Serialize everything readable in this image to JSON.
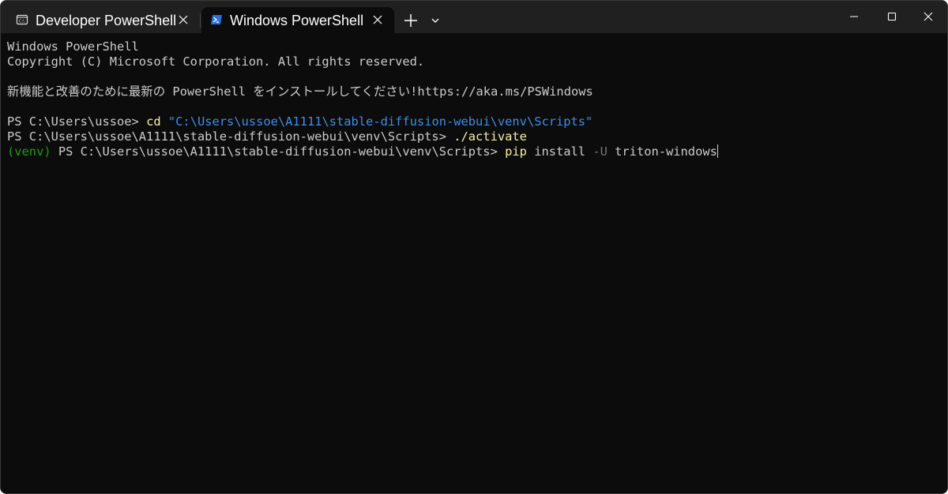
{
  "tabs": [
    {
      "label": "Developer PowerShell",
      "icon": "console-icon",
      "active": false
    },
    {
      "label": "Windows PowerShell",
      "icon": "powershell-icon",
      "active": true
    }
  ],
  "titlebar": {
    "new_tab_icon": "plus-icon",
    "dropdown_icon": "chevron-down-icon",
    "window_controls": [
      "minimize-icon",
      "maximize-icon",
      "close-icon"
    ]
  },
  "terminal": {
    "header_line1": "Windows PowerShell",
    "header_line2": "Copyright (C) Microsoft Corporation. All rights reserved.",
    "upgrade_notice": "新機能と改善のために最新の PowerShell をインストールしてください!https://aka.ms/PSWindows",
    "cmd1": {
      "prompt": "PS C:\\Users\\ussoe> ",
      "command": "cd",
      "argument": "\"C:\\Users\\ussoe\\A1111\\stable-diffusion-webui\\venv\\Scripts\""
    },
    "cmd2": {
      "prompt": "PS C:\\Users\\ussoe\\A1111\\stable-diffusion-webui\\venv\\Scripts> ",
      "command": "./activate"
    },
    "cmd3": {
      "venv": "(venv)",
      "prompt": " PS C:\\Users\\ussoe\\A1111\\stable-diffusion-webui\\venv\\Scripts> ",
      "command": "pip",
      "args1": " install ",
      "flag": "-U",
      "args2": " triton-windows"
    }
  },
  "colors": {
    "background": "#0c0c0c",
    "titlebar": "#202020",
    "text": "#cccccc",
    "command": "#f9f1a5",
    "string": "#3b8eea",
    "venv": "#13a10e",
    "flag": "#767676"
  }
}
